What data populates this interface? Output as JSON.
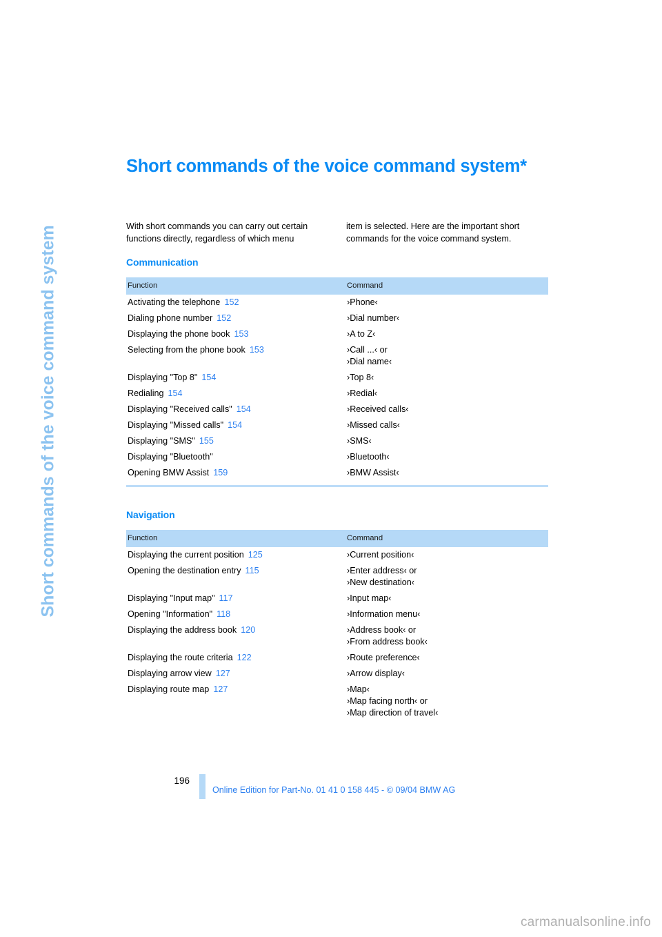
{
  "side_tab": {
    "label": "Short commands of the voice command system"
  },
  "heading": {
    "title": "Short commands of the voice command system*"
  },
  "intro": {
    "left": "With short commands you can carry out certain functions directly, regardless of which menu",
    "right": "item is selected. Here are the important short commands for the voice command system."
  },
  "sections": [
    {
      "title": "Communication",
      "columns": {
        "function": "Function",
        "command": "Command"
      },
      "rows": [
        {
          "function": "Activating the telephone",
          "page": "152",
          "commands": [
            "›Phone‹"
          ]
        },
        {
          "function": "Dialing phone number",
          "page": "152",
          "commands": [
            "›Dial number‹"
          ]
        },
        {
          "function": "Displaying the phone book",
          "page": "153",
          "commands": [
            "›A to Z‹"
          ]
        },
        {
          "function": "Selecting from the phone book",
          "page": "153",
          "commands": [
            "›Call ...‹ or",
            "›Dial name‹"
          ]
        },
        {
          "function": "Displaying \"Top 8\"",
          "page": "154",
          "commands": [
            "›Top 8‹"
          ]
        },
        {
          "function": "Redialing",
          "page": "154",
          "commands": [
            "›Redial‹"
          ]
        },
        {
          "function": "Displaying \"Received calls\"",
          "page": "154",
          "commands": [
            "›Received calls‹"
          ]
        },
        {
          "function": "Displaying \"Missed calls\"",
          "page": "154",
          "commands": [
            "›Missed calls‹"
          ]
        },
        {
          "function": "Displaying \"SMS\"",
          "page": "155",
          "commands": [
            "›SMS‹"
          ]
        },
        {
          "function": "Displaying \"Bluetooth\"",
          "page": "",
          "commands": [
            "›Bluetooth‹"
          ]
        },
        {
          "function": "Opening BMW Assist",
          "page": "159",
          "commands": [
            "›BMW Assist‹"
          ]
        }
      ]
    },
    {
      "title": "Navigation",
      "columns": {
        "function": "Function",
        "command": "Command"
      },
      "rows": [
        {
          "function": "Displaying the current position",
          "page": "125",
          "commands": [
            "›Current position‹"
          ]
        },
        {
          "function": "Opening the destination entry",
          "page": "115",
          "commands": [
            "›Enter address‹ or",
            "›New destination‹"
          ]
        },
        {
          "function": "Displaying \"Input map\"",
          "page": "117",
          "commands": [
            "›Input map‹"
          ]
        },
        {
          "function": "Opening \"Information\"",
          "page": "118",
          "commands": [
            "›Information menu‹"
          ]
        },
        {
          "function": "Displaying the address book",
          "page": "120",
          "commands": [
            "›Address book‹ or",
            "›From address book‹"
          ]
        },
        {
          "function": "Displaying the route criteria",
          "page": "122",
          "commands": [
            "›Route preference‹"
          ]
        },
        {
          "function": "Displaying arrow view",
          "page": "127",
          "commands": [
            "›Arrow display‹"
          ]
        },
        {
          "function": "Displaying route map",
          "page": "127",
          "commands": [
            "›Map‹",
            "›Map facing north‹ or",
            "›Map direction of travel‹"
          ]
        }
      ]
    }
  ],
  "footer": {
    "page_number": "196",
    "note": "Online Edition for Part-No. 01 41 0 158 445 - © 09/04 BMW AG"
  },
  "watermark": {
    "text": "carmanualsonline.info"
  },
  "colors": {
    "accent_blue": "#0a8bf5",
    "link_blue": "#2b7ff0",
    "header_band": "#b5d9f7",
    "side_tab": "#8cc3f0"
  }
}
